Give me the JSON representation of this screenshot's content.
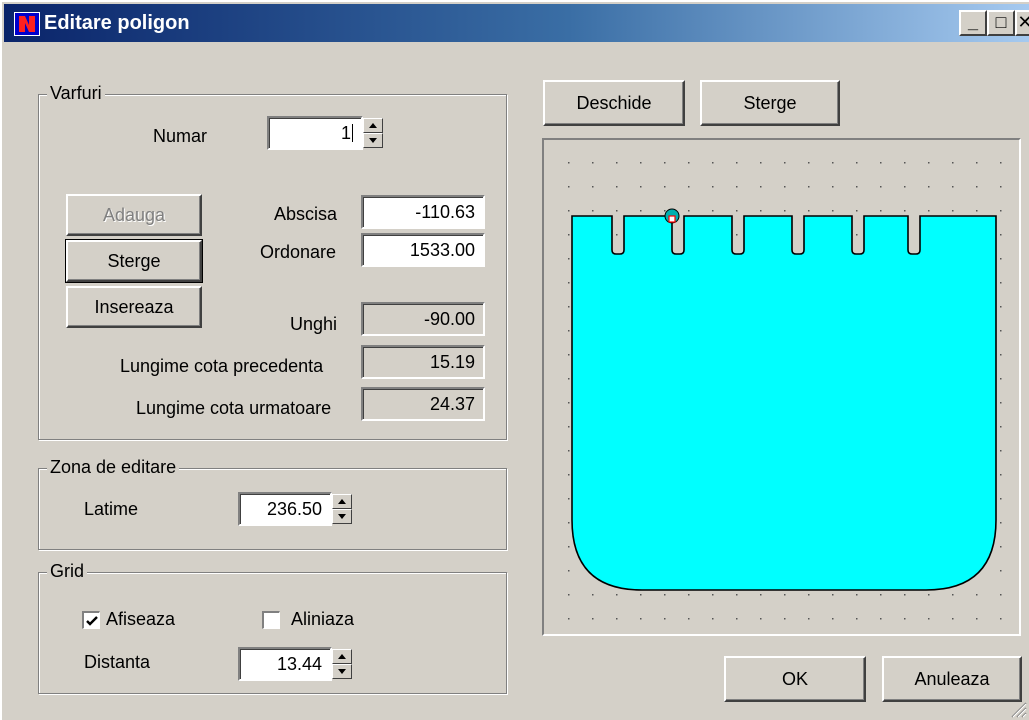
{
  "window": {
    "title": "Editare poligon",
    "minimize_glyph": "_",
    "maximize_glyph": "□",
    "close_glyph": "✕",
    "app_icon": "app-logo-icon"
  },
  "varfuri": {
    "legend": "Varfuri",
    "numar_label": "Numar",
    "numar_value": "1",
    "add_button": "Adauga",
    "delete_button": "Sterge",
    "insert_button": "Insereaza",
    "abscisa_label": "Abscisa",
    "abscisa_value": "-110.63",
    "ordonare_label": "Ordonare",
    "ordonare_value": "1533.00",
    "unghi_label": "Unghi",
    "unghi_value": "-90.00",
    "prev_label": "Lungime cota precedenta",
    "prev_value": "15.19",
    "next_label": "Lungime cota urmatoare",
    "next_value": "24.37"
  },
  "zona": {
    "legend": "Zona de editare",
    "latime_label": "Latime",
    "latime_value": "236.50"
  },
  "grid": {
    "legend": "Grid",
    "afiseaza_label": "Afiseaza",
    "afiseaza_checked": true,
    "aliniaza_label": "Aliniaza",
    "aliniaza_checked": false,
    "distanta_label": "Distanta",
    "distanta_value": "13.44"
  },
  "toolbar": {
    "open_button": "Deschide",
    "clear_button": "Sterge"
  },
  "footer": {
    "ok_button": "OK",
    "cancel_button": "Anuleaza"
  },
  "colors": {
    "polygon_fill": "#00ffff",
    "polygon_stroke": "#000000",
    "face": "#d4d0c8",
    "title_start": "#0a246a",
    "title_end": "#a6caf0",
    "vertex_marker": "#ff0000"
  }
}
